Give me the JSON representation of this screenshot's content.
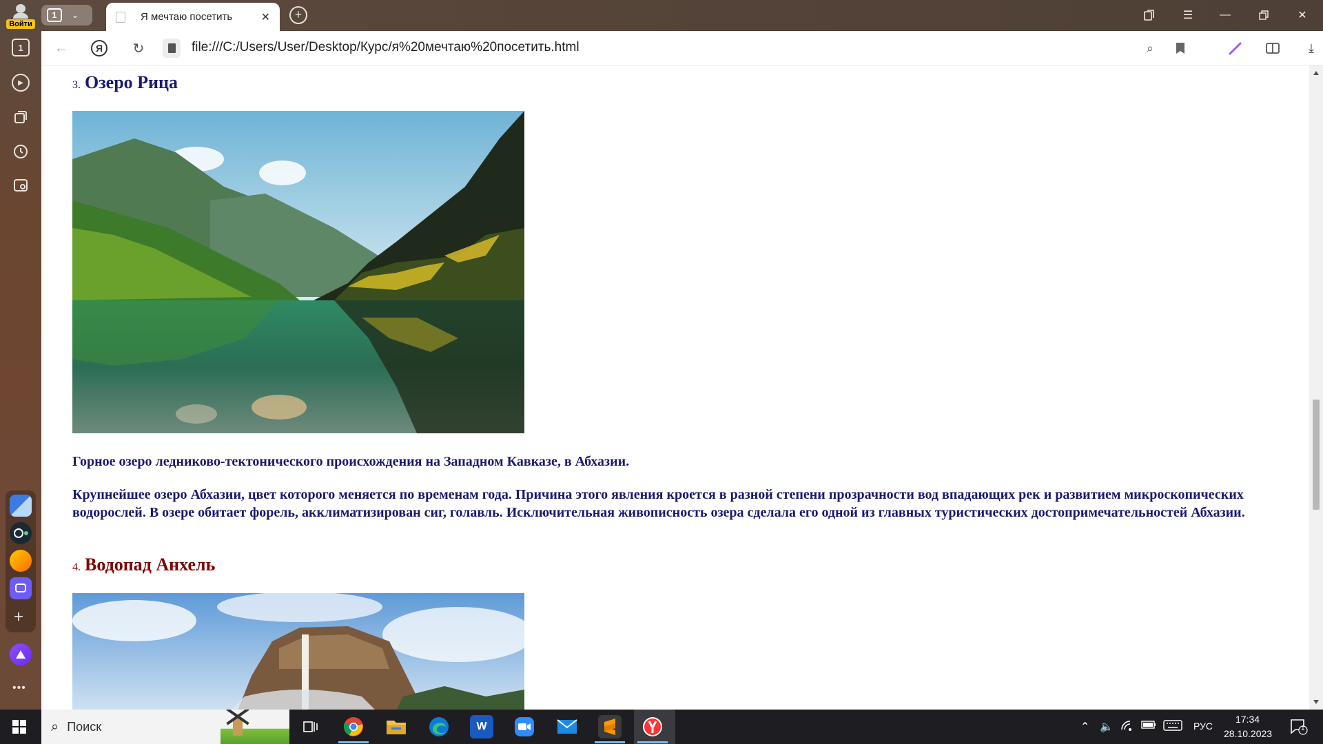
{
  "sidebar": {
    "login_label": "Войти",
    "tab_count": "1",
    "icons": [
      "tab-counter-icon",
      "play-icon",
      "collections-icon",
      "history-icon",
      "screenshot-icon"
    ],
    "apps": [
      "window-app-icon",
      "browser-circle-icon",
      "mail-app-icon",
      "messenger-app-icon"
    ],
    "add_label": "+",
    "more_label": "•••"
  },
  "tabbar": {
    "tab_count": "1",
    "active_tab_title": "Я мечтаю посетить",
    "close_label": "✕",
    "new_tab_label": "+"
  },
  "addressbar": {
    "url": "file:///C:/Users/User/Desktop/Курс/я%20мечтаю%20посетить.html",
    "ya_label": "Я"
  },
  "page": {
    "items": [
      {
        "number": "3.",
        "title": "Озеро Рица",
        "color": "#191970",
        "paragraphs": [
          "Горное озеро ледниково-тектонического происхождения на Западном Кавказе, в Абхазии.",
          "Крупнейшее озеро Абхазии, цвет которого меняется по временам года. Причина этого явления кроется в разной степени прозрачности вод впадающих рек и развитием микроскопических водорослей. В озере обитает форель, акклиматизирован сиг, голавль. Исключительная живописность озера сделала его одной из главных туристических достопримечательностей Абхазии."
        ]
      },
      {
        "number": "4.",
        "title": "Водопад Анхель",
        "color": "#800000"
      }
    ]
  },
  "taskbar": {
    "search_placeholder": "Поиск",
    "apps": [
      "task-view-icon",
      "chrome-icon",
      "file-explorer-icon",
      "edge-icon",
      "word-icon",
      "zoom-icon",
      "mail-icon",
      "sublime-icon",
      "yandex-browser-icon"
    ],
    "language": "РУС",
    "time": "17:34",
    "date": "28.10.2023",
    "notification_count": "1"
  }
}
